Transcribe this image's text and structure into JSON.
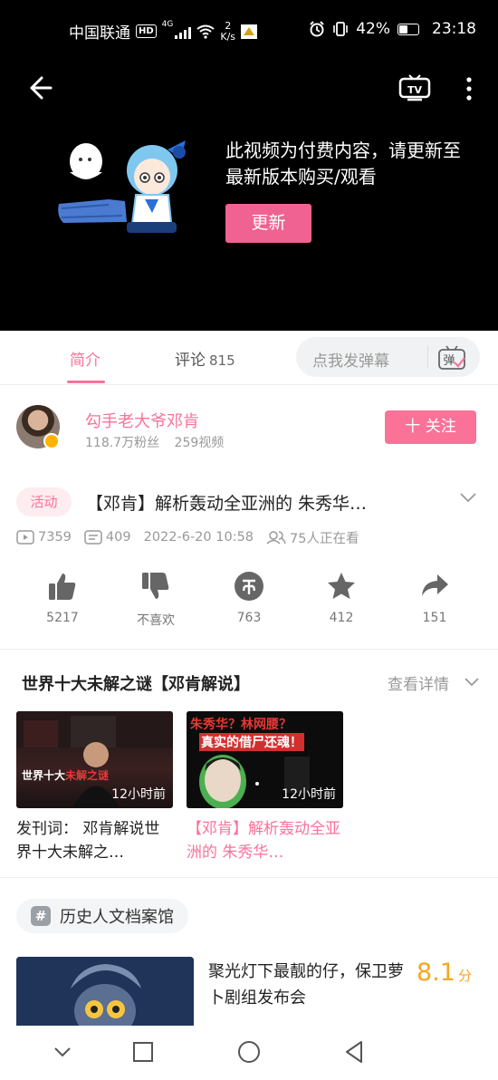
{
  "status_bar": {
    "carrier": "中国联通",
    "hd": "HD",
    "net_type": "4G",
    "speed_value": "2",
    "speed_unit": "K/s",
    "battery": "42%",
    "time": "23:18"
  },
  "player": {
    "message": "此视频为付费内容，请更新至最新版本购买/观看",
    "update_button": "更新"
  },
  "tabs": {
    "intro": "简介",
    "comments": "评论",
    "comments_count": "815",
    "danmaku_placeholder": "点我发弹幕",
    "danmaku_icon_char": "弹"
  },
  "uploader": {
    "name": "勾手老大爷邓肯",
    "fans": "118.7万粉丝",
    "videos": "259视频",
    "follow_button": "十 关注"
  },
  "video": {
    "tag": "活动",
    "title": "【邓肯】解析轰动全亚洲的 朱秀华…",
    "views": "7359",
    "danmaku_count": "409",
    "date": "2022-6-20 10:58",
    "watching": "75人正在看"
  },
  "actions": {
    "like": "5217",
    "dislike": "不喜欢",
    "coin": "763",
    "favorite": "412",
    "share": "151"
  },
  "series": {
    "title": "世界十大未解之谜【邓肯解说】",
    "more": "查看详情",
    "items": [
      {
        "title": "发刊词： 邓肯解说世界十大未解之…",
        "time": "12小时前",
        "overlay_white": "世界十大",
        "overlay_red": "未解之谜",
        "color": "#222222"
      },
      {
        "title": "【邓肯】解析轰动全亚洲的 朱秀华…",
        "time": "12小时前",
        "overlay_top": "朱秀华？林网腰？",
        "overlay_bottom": "真实的借尸还魂！",
        "color": "#fb7299"
      }
    ]
  },
  "channel": {
    "hash": "#",
    "name": "历史人文档案馆"
  },
  "recommend": {
    "title": "聚光灯下最靓的仔，保卫萝卜剧组发布会",
    "score": "8.1",
    "score_unit": "分"
  },
  "colors": {
    "accent": "#fb7299",
    "score": "#f5a623"
  }
}
